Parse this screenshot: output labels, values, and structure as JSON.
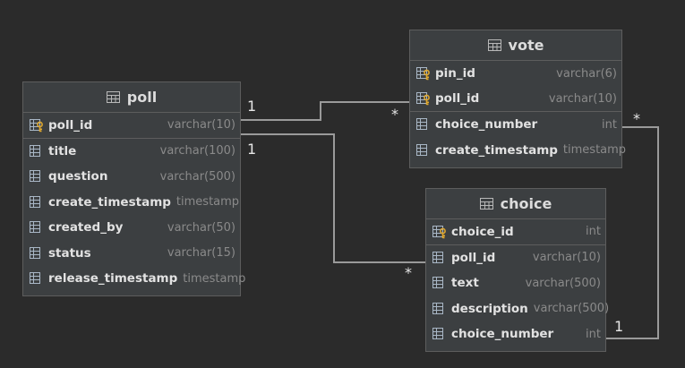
{
  "tables": {
    "poll": {
      "name": "poll",
      "columns": [
        {
          "name": "poll_id",
          "type": "varchar(10)",
          "key": "pk"
        },
        {
          "name": "title",
          "type": "varchar(100)",
          "key": ""
        },
        {
          "name": "question",
          "type": "varchar(500)",
          "key": ""
        },
        {
          "name": "create_timestamp",
          "type": "timestamp",
          "key": ""
        },
        {
          "name": "created_by",
          "type": "varchar(50)",
          "key": ""
        },
        {
          "name": "status",
          "type": "varchar(15)",
          "key": ""
        },
        {
          "name": "release_timestamp",
          "type": "timestamp",
          "key": ""
        }
      ]
    },
    "vote": {
      "name": "vote",
      "columns": [
        {
          "name": "pin_id",
          "type": "varchar(6)",
          "key": "pk"
        },
        {
          "name": "poll_id",
          "type": "varchar(10)",
          "key": "pk"
        },
        {
          "name": "choice_number",
          "type": "int",
          "key": ""
        },
        {
          "name": "create_timestamp",
          "type": "timestamp",
          "key": ""
        }
      ]
    },
    "choice": {
      "name": "choice",
      "columns": [
        {
          "name": "choice_id",
          "type": "int",
          "key": "pk"
        },
        {
          "name": "poll_id",
          "type": "varchar(10)",
          "key": ""
        },
        {
          "name": "text",
          "type": "varchar(500)",
          "key": ""
        },
        {
          "name": "description",
          "type": "varchar(500)",
          "key": ""
        },
        {
          "name": "choice_number",
          "type": "int",
          "key": ""
        }
      ]
    }
  },
  "relations": {
    "poll_vote": {
      "from_card": "1",
      "to_card": "*"
    },
    "poll_choice": {
      "from_card": "1",
      "to_card": "*"
    },
    "choice_vote": {
      "from_card": "1",
      "to_card": "*"
    }
  },
  "colors": {
    "background": "#2b2b2b",
    "table_bg": "#3c3f41",
    "border": "#5d5d5d",
    "connector": "#9a9a9a",
    "key_icon": "#e0a82e"
  }
}
